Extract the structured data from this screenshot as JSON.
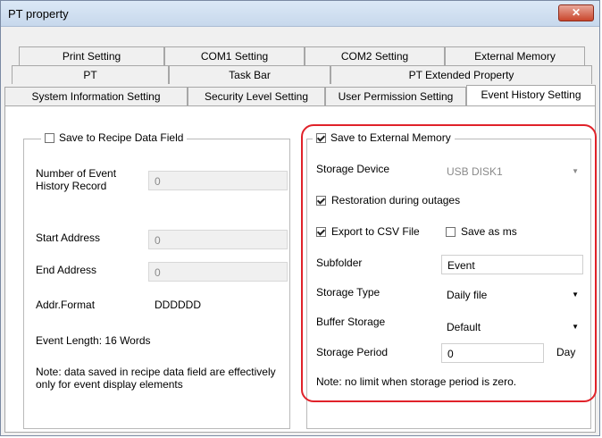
{
  "window": {
    "title": "PT property",
    "close_glyph": "✕"
  },
  "tabs": {
    "row1": [
      "Print Setting",
      "COM1 Setting",
      "COM2 Setting",
      "External Memory"
    ],
    "row2": [
      "PT",
      "Task Bar",
      "PT Extended Property"
    ],
    "row3": [
      "System Information Setting",
      "Security Level Setting",
      "User Permission Setting",
      "Event History Setting"
    ],
    "active": "Event History Setting"
  },
  "recipe": {
    "checkbox_label": "Save to Recipe Data Field",
    "checked": false,
    "num_records_label": "Number of Event History Record",
    "num_records_value": "0",
    "start_address_label": "Start Address",
    "start_address_value": "0",
    "end_address_label": "End Address",
    "end_address_value": "0",
    "addr_format_label": "Addr.Format",
    "addr_format_value": "DDDDDD",
    "event_length": "Event Length: 16 Words",
    "note": "Note: data saved in recipe data field are effectively only for event display elements"
  },
  "external": {
    "checkbox_label": "Save to External Memory",
    "checked": true,
    "storage_device_label": "Storage Device",
    "storage_device_value": "USB DISK1",
    "restoration_label": "Restoration during outages",
    "restoration_checked": true,
    "export_csv_label": "Export to CSV File",
    "export_csv_checked": true,
    "save_ms_label": "Save as ms",
    "save_ms_checked": false,
    "subfolder_label": "Subfolder",
    "subfolder_value": "Event",
    "storage_type_label": "Storage Type",
    "storage_type_value": "Daily file",
    "buffer_storage_label": "Buffer Storage",
    "buffer_storage_value": "Default",
    "storage_period_label": "Storage Period",
    "storage_period_value": "0",
    "storage_period_unit": "Day",
    "note": "Note: no limit when storage period is zero."
  },
  "colors": {
    "highlight": "#e0222a",
    "close_button": "#c9462c"
  }
}
